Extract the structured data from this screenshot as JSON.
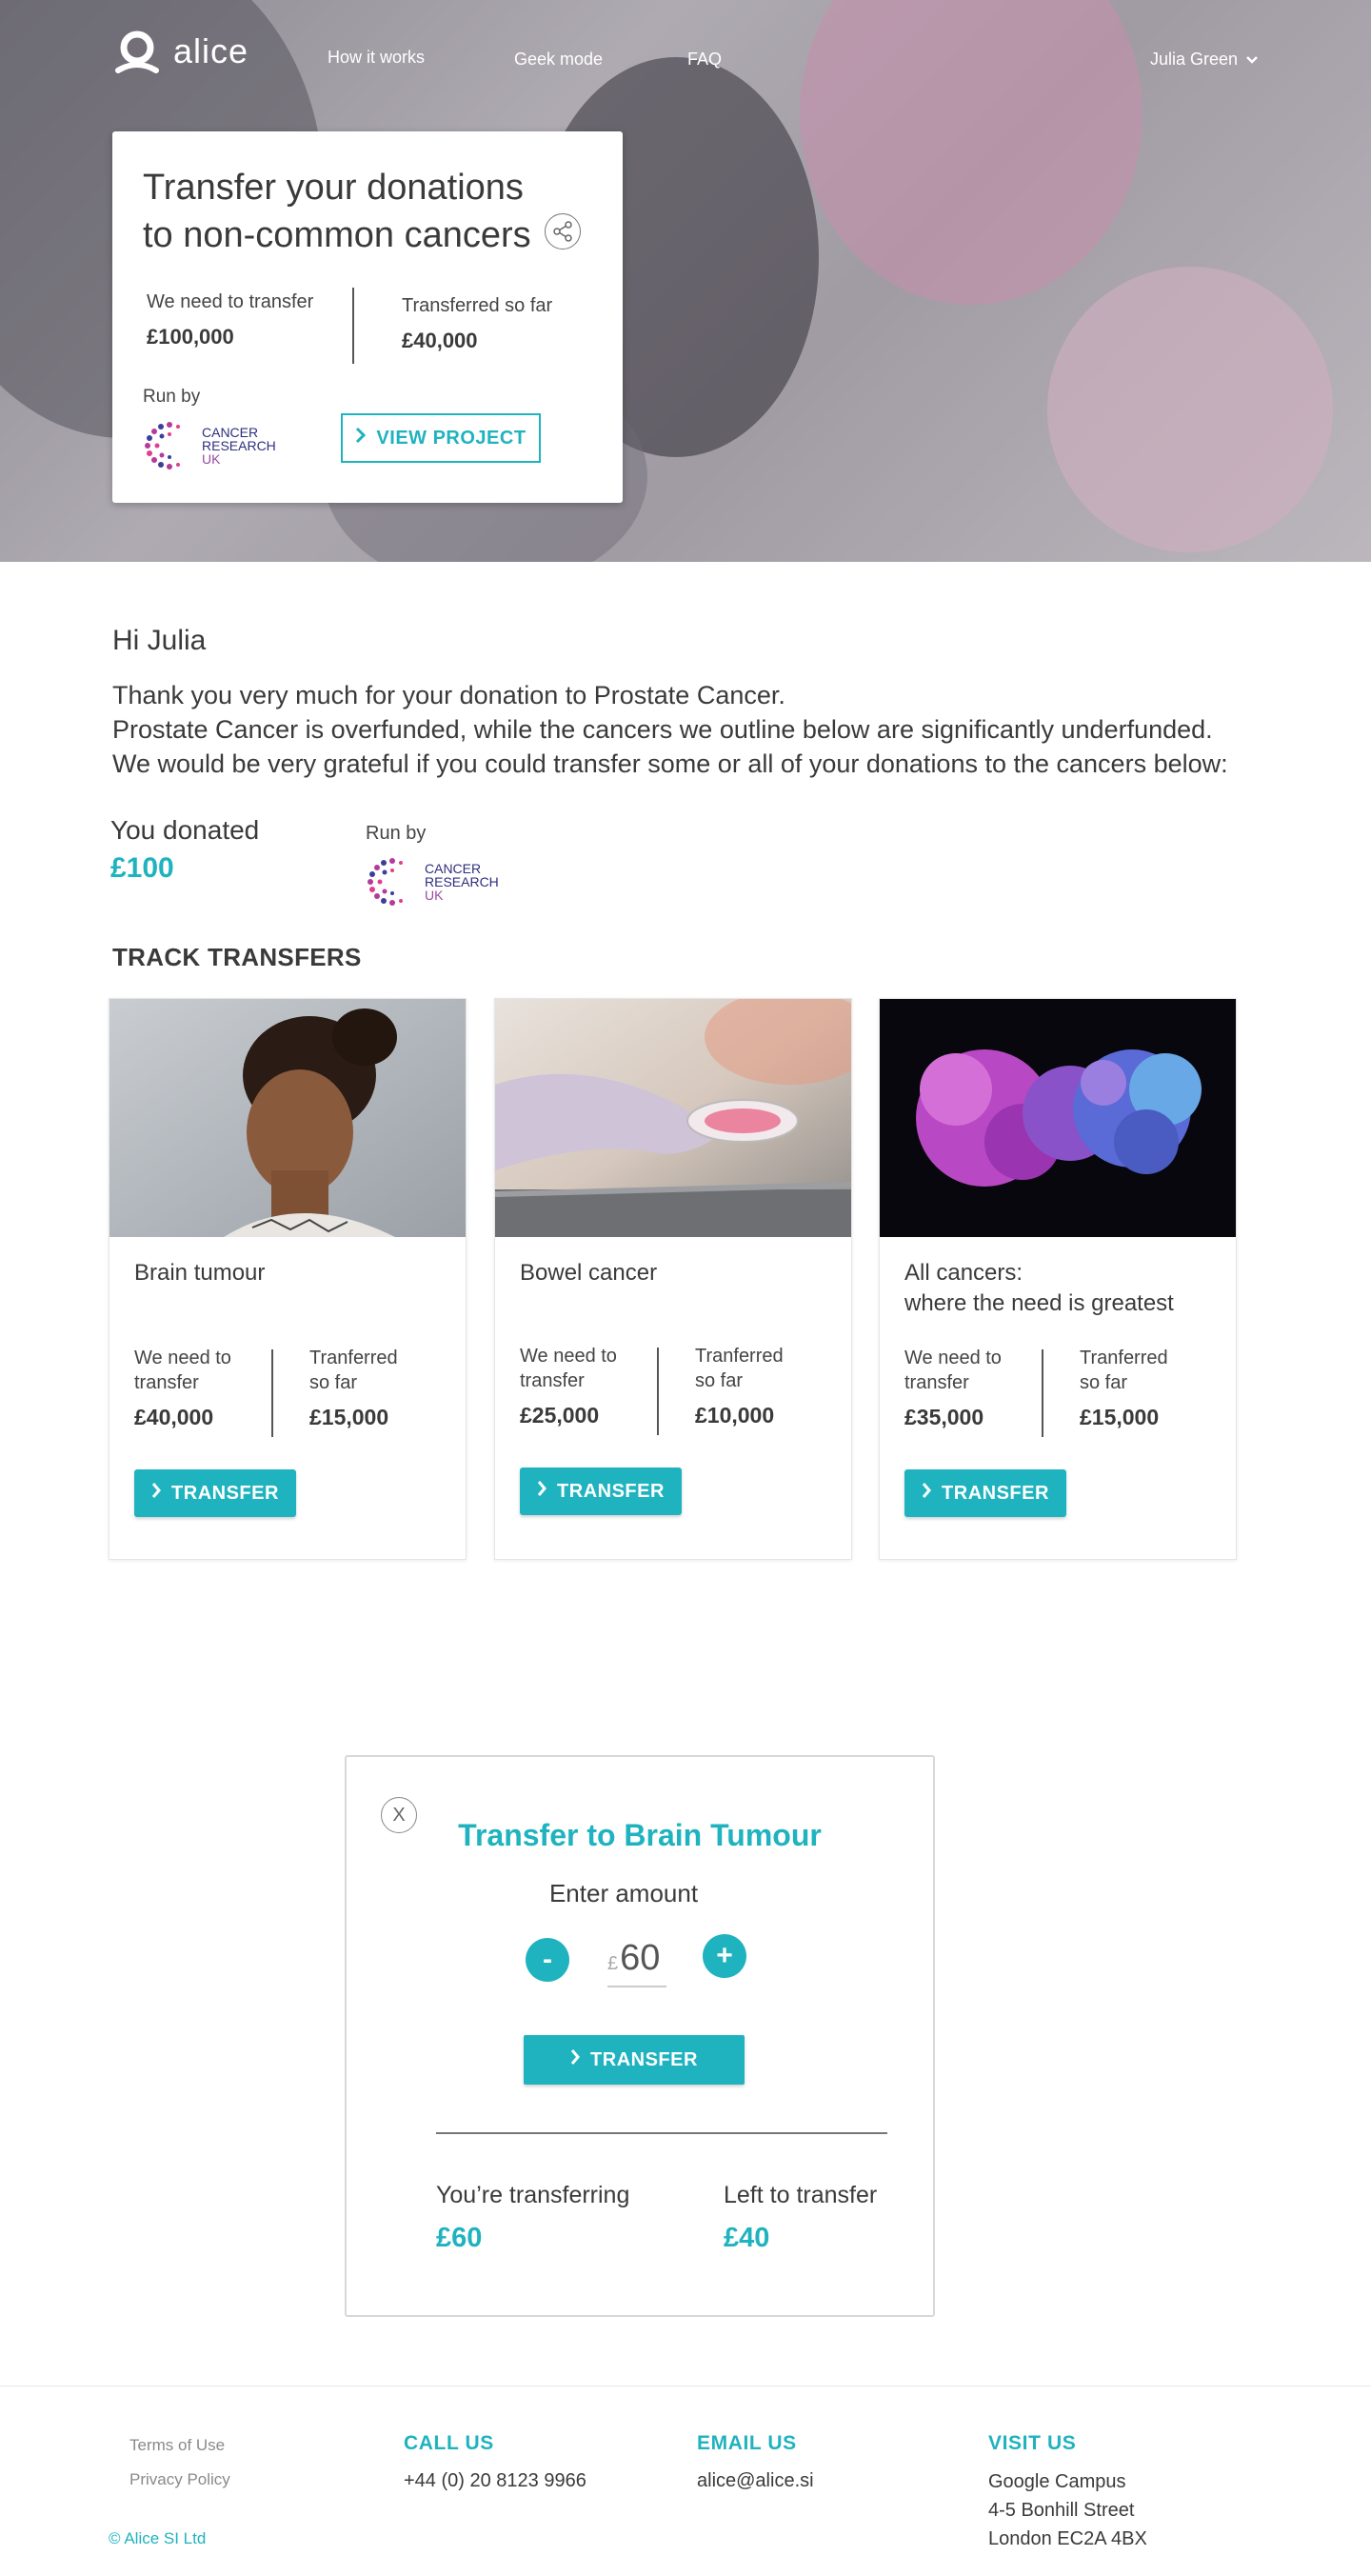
{
  "nav": {
    "logo_text": "alice",
    "links": [
      "How it works",
      "Geek mode",
      "FAQ"
    ],
    "user_name": "Julia Green"
  },
  "hero_card": {
    "title_line1": "Transfer your donations",
    "title_line2": "to non-common cancers",
    "need_label": "We need to transfer",
    "need_value": "£100,000",
    "so_far_label": "Transferred so far",
    "so_far_value": "£40,000",
    "run_by": "Run by",
    "org_line1": "CANCER",
    "org_line2": "RESEARCH",
    "org_line3": "UK",
    "button_label": "VIEW PROJECT"
  },
  "intro": {
    "greeting": "Hi Julia",
    "line1": "Thank you very much for your donation to Prostate Cancer.",
    "line2": "Prostate Cancer is overfunded, while the cancers we outline below are significantly underfunded.",
    "line3": "We would be very grateful if you could transfer some or all of your donations to the cancers below:",
    "donated_label": "You donated",
    "donated_value": "£100",
    "run_by": "Run by"
  },
  "track": {
    "title": "TRACK TRANSFERS",
    "cards": [
      {
        "title_line1": "Brain tumour",
        "title_line2": "",
        "need_label_1": "We need to",
        "need_label_2": "transfer",
        "need_value": "£40,000",
        "so_far_label_1": "Tranferred",
        "so_far_label_2": "so far",
        "so_far_value": "£15,000",
        "button": "TRANSFER"
      },
      {
        "title_line1": "Bowel cancer",
        "title_line2": "",
        "need_label_1": "We need to",
        "need_label_2": "transfer",
        "need_value": "£25,000",
        "so_far_label_1": "Tranferred",
        "so_far_label_2": "so far",
        "so_far_value": "£10,000",
        "button": "TRANSFER"
      },
      {
        "title_line1": "All cancers:",
        "title_line2": "where the need is greatest",
        "need_label_1": "We need to",
        "need_label_2": "transfer",
        "need_value": "£35,000",
        "so_far_label_1": "Tranferred",
        "so_far_label_2": "so far",
        "so_far_value": "£15,000",
        "button": "TRANSFER"
      }
    ]
  },
  "modal": {
    "close_label": "X",
    "title": "Transfer to Brain Tumour",
    "enter_amount": "Enter amount",
    "minus": "-",
    "plus": "+",
    "currency": "£",
    "amount": "60",
    "button": "TRANSFER",
    "transferring_label": "You’re transferring",
    "transferring_value": "£60",
    "left_label": "Left to transfer",
    "left_value": "£40"
  },
  "footer": {
    "terms": "Terms of Use",
    "privacy": "Privacy Policy",
    "copyright": "Alice SI Ltd",
    "call_head": "CALL US",
    "call_value": "+44 (0) 20 8123 9966",
    "email_head": "EMAIL US",
    "email_value": "alice@alice.si",
    "visit_head": "VISIT US",
    "visit_line1": "Google Campus",
    "visit_line2": "4-5 Bonhill Street",
    "visit_line3": "London EC2A 4BX"
  },
  "colors": {
    "accent": "#1fb3bf",
    "text": "#3a3a3a",
    "hero_overlay": "#a9a5ad"
  }
}
